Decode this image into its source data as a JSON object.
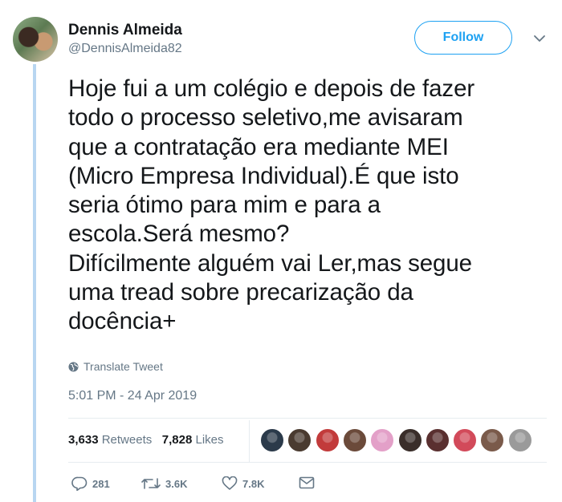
{
  "user": {
    "name": "Dennis Almeida",
    "handle": "@DennisAlmeida82"
  },
  "follow_label": "Follow",
  "tweet": {
    "text": "Hoje fui a um colégio e depois de fazer\ntodo o processo seletivo,me avisaram\nque a contratação era mediante MEI\n(Micro Empresa Individual).É que isto\nseria ótimo para mim e para a\nescola.Será mesmo?\nDifícilmente alguém vai Ler,mas segue\numa tread sobre precarização da\ndocência+",
    "translate_label": "Translate Tweet",
    "timestamp": "5:01 PM - 24 Apr 2019"
  },
  "stats": {
    "retweets_count": "3,633",
    "retweets_label": "Retweets",
    "likes_count": "7,828",
    "likes_label": "Likes"
  },
  "likers": [
    {
      "color": "#2b3a4a"
    },
    {
      "color": "#4a3b30"
    },
    {
      "color": "#c23b3b"
    },
    {
      "color": "#6b4a3a"
    },
    {
      "color": "#e3a0c8"
    },
    {
      "color": "#3a2e2a"
    },
    {
      "color": "#5a3030"
    },
    {
      "color": "#d24a5a"
    },
    {
      "color": "#7a5a4a"
    },
    {
      "color": "#9a9a9a"
    }
  ],
  "actions": {
    "replies": "281",
    "retweets": "3.6K",
    "likes": "7.8K"
  },
  "colors": {
    "accent": "#1da1f2",
    "secondary_text": "#657786",
    "thread_line": "#b8d6f1"
  }
}
